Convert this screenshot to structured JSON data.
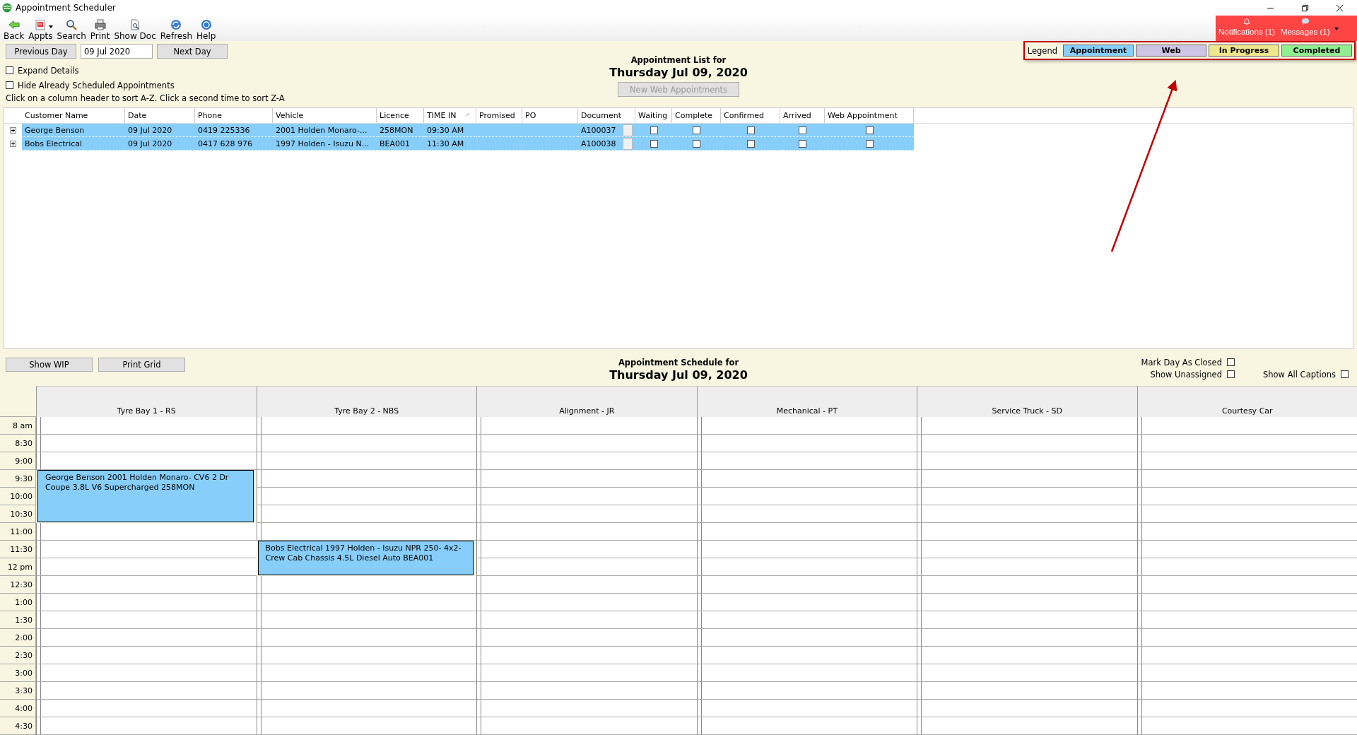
{
  "window": {
    "title": "Appointment Scheduler"
  },
  "toolbar": [
    {
      "label": "Back",
      "dropdown": false
    },
    {
      "label": "Appts",
      "dropdown": true
    },
    {
      "label": "Search",
      "dropdown": false
    },
    {
      "label": "Print",
      "dropdown": false
    },
    {
      "label": "Show Doc",
      "dropdown": false
    },
    {
      "label": "Refresh",
      "dropdown": false
    },
    {
      "label": "Help",
      "dropdown": false
    }
  ],
  "alerts": [
    {
      "label": "Notifications (1)"
    },
    {
      "label": "Messages (1)"
    }
  ],
  "day_nav": {
    "previous": "Previous Day",
    "date": "09 Jul 2020",
    "next": "Next Day"
  },
  "options": [
    {
      "label": "Expand Details",
      "checked": false
    },
    {
      "label": "Hide Already Scheduled Appointments",
      "checked": false
    }
  ],
  "hint": "Click on a column header to sort A-Z.  Click a second time to sort Z-A",
  "list_heading": {
    "title": "Appointment List for",
    "date": "Thursday Jul 09, 2020",
    "button": {
      "label": "New Web Appointments",
      "disabled": true
    }
  },
  "legend": {
    "label": "Legend",
    "items": [
      {
        "label": "Appointment",
        "color": "#87cefa"
      },
      {
        "label": "Web",
        "color": "#cdc5e3"
      },
      {
        "label": "In Progress",
        "color": "#f0e68c"
      },
      {
        "label": "Completed",
        "color": "#90ee90"
      }
    ]
  },
  "table": {
    "columns": [
      {
        "label": "Customer Name",
        "sorted": false
      },
      {
        "label": "Date",
        "sorted": false
      },
      {
        "label": "Phone",
        "sorted": false
      },
      {
        "label": "Vehicle",
        "sorted": false
      },
      {
        "label": "Licence",
        "sorted": false
      },
      {
        "label": "TIME IN",
        "sorted": true
      },
      {
        "label": "Promised",
        "sorted": false
      },
      {
        "label": "PO",
        "sorted": false
      },
      {
        "label": "Document",
        "sorted": false
      },
      {
        "label": "Waiting",
        "sorted": false
      },
      {
        "label": "Complete",
        "sorted": false
      },
      {
        "label": "Confirmed",
        "sorted": false
      },
      {
        "label": "Arrived",
        "sorted": false
      },
      {
        "label": "Web Appointment",
        "sorted": false
      }
    ],
    "rows": [
      {
        "selected": true,
        "expanded": false,
        "cells": [
          "George Benson",
          "09 Jul 2020",
          "0419 225336",
          "2001 Holden Monaro-...",
          "258MON",
          "09:30 AM",
          "",
          "",
          "A100037"
        ],
        "checks": [
          false,
          false,
          false,
          false,
          false
        ]
      },
      {
        "selected": true,
        "expanded": false,
        "cells": [
          "Bobs Electrical",
          "09 Jul 2020",
          "0417 628 976",
          "1997 Holden - Isuzu N...",
          "BEA001",
          "11:30 AM",
          "",
          "",
          "A100038"
        ],
        "checks": [
          false,
          false,
          false,
          false,
          false
        ]
      }
    ]
  },
  "schedule_bar": {
    "buttons": [
      "Show WIP",
      "Print Grid"
    ],
    "title": "Appointment Schedule for",
    "date": "Thursday Jul 09, 2020",
    "options": [
      {
        "label": "Mark Day As Closed",
        "checked": false
      },
      {
        "label": "Show Unassigned",
        "checked": false
      },
      {
        "label": "Show All Captions",
        "checked": false
      }
    ]
  },
  "schedule": {
    "times": [
      "8 am",
      "8:30",
      "9:00",
      "9:30",
      "10:00",
      "10:30",
      "11:00",
      "11:30",
      "12 pm",
      "12:30",
      "1:00",
      "1:30",
      "2:00",
      "2:30",
      "3:00",
      "3:30",
      "4:00",
      "4:30"
    ],
    "bays": [
      {
        "name": "Tyre Bay 1 - RS",
        "slots": [
          {
            "kind": "free"
          },
          {
            "kind": "free"
          },
          {
            "kind": "free"
          },
          {
            "kind": "appointment",
            "text": "George Benson  2001 Holden Monaro- CV6 2 Dr Coupe  3.8L V6 Supercharged 258MON",
            "color": "#87cefa"
          },
          {
            "kind": "booked"
          },
          {
            "kind": "booked"
          },
          {
            "kind": "free"
          },
          {
            "kind": "free"
          },
          {
            "kind": "free"
          },
          {
            "kind": "free"
          },
          {
            "kind": "free"
          },
          {
            "kind": "free"
          },
          {
            "kind": "free"
          },
          {
            "kind": "free"
          },
          {
            "kind": "free"
          },
          {
            "kind": "free"
          },
          {
            "kind": "free"
          },
          {
            "kind": "free"
          }
        ]
      },
      {
        "name": "Tyre Bay 2 - NBS",
        "slots": [
          {
            "kind": "free"
          },
          {
            "kind": "free"
          },
          {
            "kind": "free"
          },
          {
            "kind": "free"
          },
          {
            "kind": "free"
          },
          {
            "kind": "free"
          },
          {
            "kind": "free"
          },
          {
            "kind": "appointment",
            "text": "Bobs Electrical  1997 Holden - Isuzu NPR 250- 4x2- Crew Cab Chassis 4.5L Diesel Auto BEA001",
            "color": "#87cefa"
          },
          {
            "kind": "booked"
          },
          {
            "kind": "free"
          },
          {
            "kind": "free"
          },
          {
            "kind": "free"
          },
          {
            "kind": "free"
          },
          {
            "kind": "free"
          },
          {
            "kind": "free"
          },
          {
            "kind": "free"
          },
          {
            "kind": "free"
          },
          {
            "kind": "free"
          }
        ]
      },
      {
        "name": "Alignment - JR",
        "slots": [
          {
            "kind": "free"
          },
          {
            "kind": "free"
          },
          {
            "kind": "free"
          },
          {
            "kind": "free"
          },
          {
            "kind": "free"
          },
          {
            "kind": "free"
          },
          {
            "kind": "free"
          },
          {
            "kind": "free"
          },
          {
            "kind": "free"
          },
          {
            "kind": "free"
          },
          {
            "kind": "free"
          },
          {
            "kind": "free"
          },
          {
            "kind": "free"
          },
          {
            "kind": "free"
          },
          {
            "kind": "free"
          },
          {
            "kind": "free"
          },
          {
            "kind": "free"
          },
          {
            "kind": "free"
          }
        ]
      },
      {
        "name": "Mechanical - PT",
        "slots": [
          {
            "kind": "free"
          },
          {
            "kind": "free"
          },
          {
            "kind": "free"
          },
          {
            "kind": "free"
          },
          {
            "kind": "free"
          },
          {
            "kind": "free"
          },
          {
            "kind": "free"
          },
          {
            "kind": "free"
          },
          {
            "kind": "free"
          },
          {
            "kind": "free"
          },
          {
            "kind": "free"
          },
          {
            "kind": "free"
          },
          {
            "kind": "free"
          },
          {
            "kind": "free"
          },
          {
            "kind": "free"
          },
          {
            "kind": "free"
          },
          {
            "kind": "free"
          },
          {
            "kind": "free"
          }
        ]
      },
      {
        "name": "Service Truck - SD",
        "slots": [
          {
            "kind": "free"
          },
          {
            "kind": "free"
          },
          {
            "kind": "free"
          },
          {
            "kind": "free"
          },
          {
            "kind": "free"
          },
          {
            "kind": "free"
          },
          {
            "kind": "free"
          },
          {
            "kind": "free"
          },
          {
            "kind": "free"
          },
          {
            "kind": "free"
          },
          {
            "kind": "free"
          },
          {
            "kind": "free"
          },
          {
            "kind": "free"
          },
          {
            "kind": "free"
          },
          {
            "kind": "free"
          },
          {
            "kind": "free"
          },
          {
            "kind": "free"
          },
          {
            "kind": "free"
          }
        ]
      },
      {
        "name": "Courtesy Car",
        "slots": [
          {
            "kind": "free"
          },
          {
            "kind": "free"
          },
          {
            "kind": "free"
          },
          {
            "kind": "free"
          },
          {
            "kind": "free"
          },
          {
            "kind": "free"
          },
          {
            "kind": "free"
          },
          {
            "kind": "free"
          },
          {
            "kind": "free"
          },
          {
            "kind": "free"
          },
          {
            "kind": "free"
          },
          {
            "kind": "free"
          },
          {
            "kind": "free"
          },
          {
            "kind": "free"
          },
          {
            "kind": "free"
          },
          {
            "kind": "free"
          },
          {
            "kind": "free"
          },
          {
            "kind": "free"
          }
        ]
      }
    ]
  }
}
